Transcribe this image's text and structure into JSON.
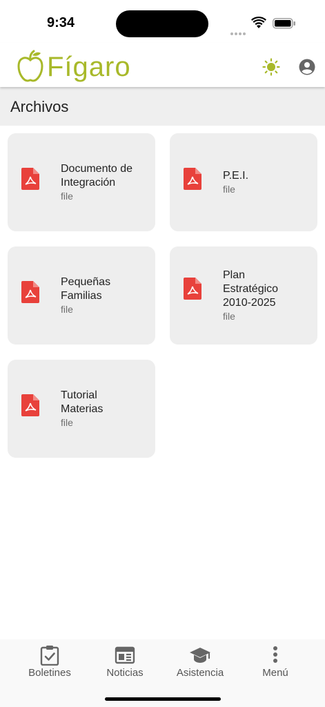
{
  "status_bar": {
    "time": "9:34"
  },
  "app": {
    "logo_text": "Fígaro",
    "brand_color": "#a8b92a",
    "theme_icon": "sun-icon",
    "account_icon": "account-circle-icon"
  },
  "section": {
    "title": "Archivos"
  },
  "files": [
    {
      "name": "Documento de Integración",
      "type": "file",
      "icon": "pdf-icon"
    },
    {
      "name": "P.E.I.",
      "type": "file",
      "icon": "pdf-icon"
    },
    {
      "name": "Pequeñas Familias",
      "type": "file",
      "icon": "pdf-icon"
    },
    {
      "name": "Plan Estratégico 2010-2025",
      "type": "file",
      "icon": "pdf-icon"
    },
    {
      "name": "Tutorial Materias",
      "type": "file",
      "icon": "pdf-icon"
    }
  ],
  "pdf_icon_color": "#e8413b",
  "bottom_nav": [
    {
      "label": "Boletines",
      "icon": "clipboard-check-icon"
    },
    {
      "label": "Noticias",
      "icon": "newspaper-icon"
    },
    {
      "label": "Asistencia",
      "icon": "graduation-cap-icon"
    },
    {
      "label": "Menú",
      "icon": "more-vertical-icon"
    }
  ]
}
